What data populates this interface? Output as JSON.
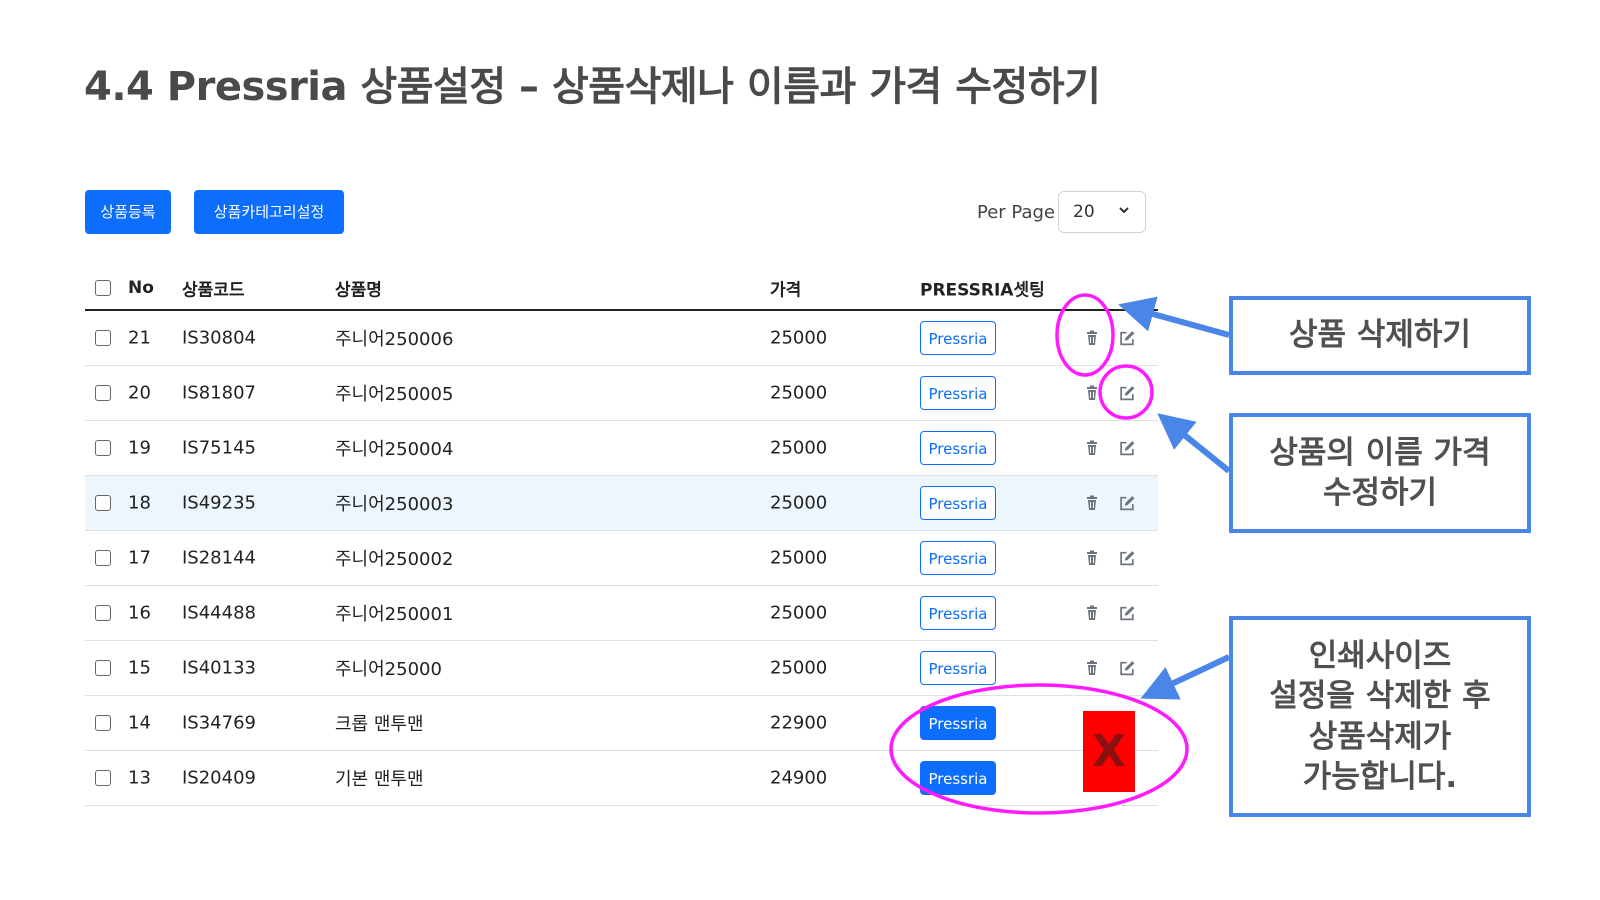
{
  "title": "4.4  Pressria 상품설정 – 상품삭제나 이름과 가격 수정하기",
  "toolbar": {
    "register_label": "상품등록",
    "category_label": "상품카테고리설정",
    "per_page_label": "Per Page",
    "per_page_value": "20"
  },
  "table": {
    "headers": {
      "no": "No",
      "code": "상품코드",
      "name": "상품명",
      "price": "가격",
      "pressria": "PRESSRIA셋팅"
    },
    "rows": [
      {
        "no": "21",
        "code": "IS30804",
        "name": "주니어250006",
        "price": "25000",
        "pressria": "Pressria"
      },
      {
        "no": "20",
        "code": "IS81807",
        "name": "주니어250005",
        "price": "25000",
        "pressria": "Pressria"
      },
      {
        "no": "19",
        "code": "IS75145",
        "name": "주니어250004",
        "price": "25000",
        "pressria": "Pressria"
      },
      {
        "no": "18",
        "code": "IS49235",
        "name": "주니어250003",
        "price": "25000",
        "pressria": "Pressria"
      },
      {
        "no": "17",
        "code": "IS28144",
        "name": "주니어250002",
        "price": "25000",
        "pressria": "Pressria"
      },
      {
        "no": "16",
        "code": "IS44488",
        "name": "주니어250001",
        "price": "25000",
        "pressria": "Pressria"
      },
      {
        "no": "15",
        "code": "IS40133",
        "name": "주니어25000",
        "price": "25000",
        "pressria": "Pressria"
      },
      {
        "no": "14",
        "code": "IS34769",
        "name": "크롭 맨투맨",
        "price": "22900",
        "pressria": "Pressria"
      },
      {
        "no": "13",
        "code": "IS20409",
        "name": "기본 맨투맨",
        "price": "24900",
        "pressria": "Pressria"
      }
    ]
  },
  "annotations": {
    "delete": "상품 삭제하기",
    "edit": "상품의 이름 가격\n수정하기",
    "print_size": "인쇄사이즈\n설정을 삭제한 후\n상품삭제가\n가능합니다.",
    "blocked_mark": "X"
  },
  "colors": {
    "primary": "#0d6efd",
    "callout_border": "#4a86e8",
    "highlight_circle": "#ff1aff",
    "blocked": "#ff0000"
  }
}
